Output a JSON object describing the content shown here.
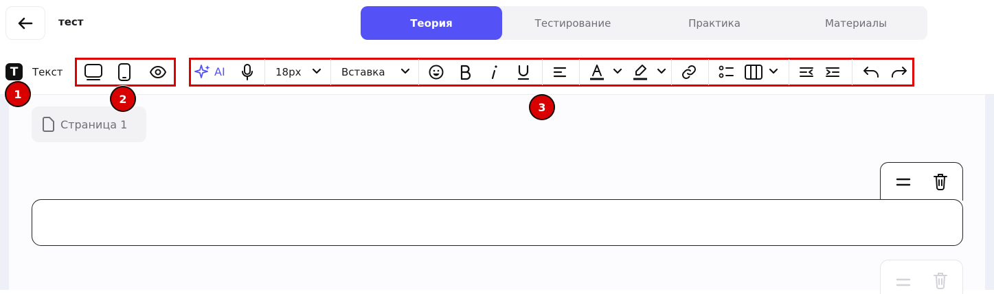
{
  "header": {
    "back_icon": "arrow-left-icon",
    "title": "тест",
    "tabs": [
      {
        "label": "Теория",
        "active": true
      },
      {
        "label": "Тестирование",
        "active": false
      },
      {
        "label": "Практика",
        "active": false
      },
      {
        "label": "Материалы",
        "active": false
      }
    ],
    "accent_color": "#5451f6"
  },
  "toolbar": {
    "block_type_icon": "text-block-icon",
    "block_type_letter": "T",
    "block_type_label": "Текст",
    "view_icons": [
      "desktop-view-icon",
      "mobile-view-icon",
      "preview-eye-icon"
    ],
    "ai_label": "AI",
    "font_size": "18px",
    "insert_label": "Вставка"
  },
  "markers": [
    "1",
    "2",
    "3"
  ],
  "editor": {
    "page_label": "Страница 1"
  }
}
